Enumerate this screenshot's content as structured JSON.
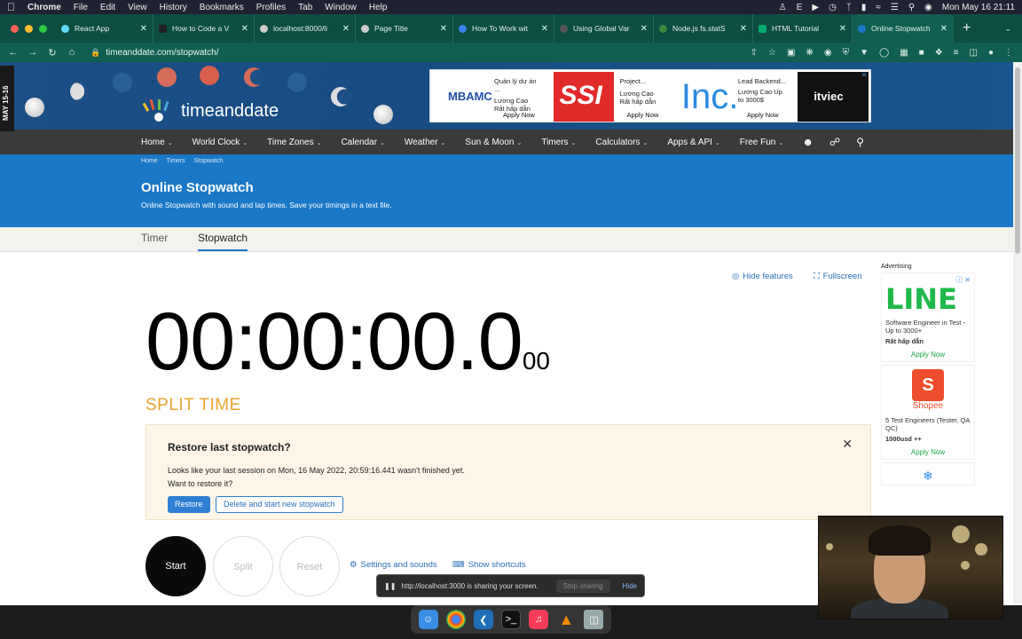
{
  "menubar": {
    "app": "Chrome",
    "items": [
      "File",
      "Edit",
      "View",
      "History",
      "Bookmarks",
      "Profiles",
      "Tab",
      "Window",
      "Help"
    ],
    "clock": "Mon May 16  21:11",
    "input_indicator": "E"
  },
  "tabs": [
    {
      "title": "React App",
      "color": "#61dafb"
    },
    {
      "title": "How to Code a V",
      "color": "#222222"
    },
    {
      "title": "localhost:8000/li",
      "color": "#cccccc"
    },
    {
      "title": "Page Title",
      "color": "#cccccc"
    },
    {
      "title": "How To Work wit",
      "color": "#3b82f6"
    },
    {
      "title": "Using Global Var",
      "color": "#555555"
    },
    {
      "title": "Node.js fs.statS",
      "color": "#3c873a"
    },
    {
      "title": "HTML Tutorial",
      "color": "#04aa6d"
    },
    {
      "title": "Online Stopwatch",
      "color": "#1a78c8",
      "active": true
    }
  ],
  "address": {
    "url": "timeanddate.com/stopwatch/"
  },
  "side_date": "MAY 15-16",
  "site": {
    "logo_text": "timeanddate",
    "nav": [
      "Home",
      "World Clock",
      "Time Zones",
      "Calendar",
      "Weather",
      "Sun & Moon",
      "Timers",
      "Calculators",
      "Apps & API",
      "Free Fun"
    ],
    "breadcrumb": [
      "Home",
      "Timers",
      "Stopwatch"
    ],
    "page_title": "Online Stopwatch",
    "page_subtitle": "Online Stopwatch with sound and lap times. Save your timings in a text file.",
    "subtabs": [
      "Timer",
      "Stopwatch"
    ]
  },
  "top_ads": [
    {
      "brand": "MBAMC",
      "text1": "Quản lý dự án",
      "text2": "...",
      "text3": "Lương Cao",
      "text4": "Rất hấp dẫn",
      "apply": "Apply Now"
    },
    {
      "brand": "SSI",
      "text1": "Project...",
      "text2": "Lương Cao",
      "text3": "Rất hấp dẫn",
      "apply": "Apply Now"
    },
    {
      "brand": "Inc.",
      "text1": "Lead Backend...",
      "text2": "Lương Cao Up",
      "text3": "to 3000$",
      "apply": "Apply Now"
    },
    {
      "brand": "itviec"
    }
  ],
  "features": {
    "hide": "Hide features",
    "fullscreen": "Fullscreen"
  },
  "stopwatch": {
    "main": "00:00:00.0",
    "small": "00",
    "split_label": "SPLIT TIME",
    "buttons": {
      "start": "Start",
      "split": "Split",
      "reset": "Reset"
    },
    "settings": "Settings and sounds",
    "shortcuts": "Show shortcuts"
  },
  "restore": {
    "title": "Restore last stopwatch?",
    "message": "Looks like your last session on Mon, 16 May 2022, 20:59:16.441 wasn't finished yet.",
    "question": "Want to restore it?",
    "restore_btn": "Restore",
    "delete_btn": "Delete and start new stopwatch"
  },
  "side_ads": {
    "label": "Advertising",
    "items": [
      {
        "brand": "LINE",
        "text": "Software Engineer in Test - Up to 3000+",
        "bold": "Rất hấp dẫn",
        "apply": "Apply Now"
      },
      {
        "brand": "Shopee",
        "text": "5 Test Engineers (Tester, QA QC)",
        "bold": "1000usd ++",
        "apply": "Apply Now"
      }
    ]
  },
  "share_bar": {
    "text": "http://localhost:3000 is sharing your screen.",
    "stop": "Stop sharing",
    "hide": "Hide"
  }
}
